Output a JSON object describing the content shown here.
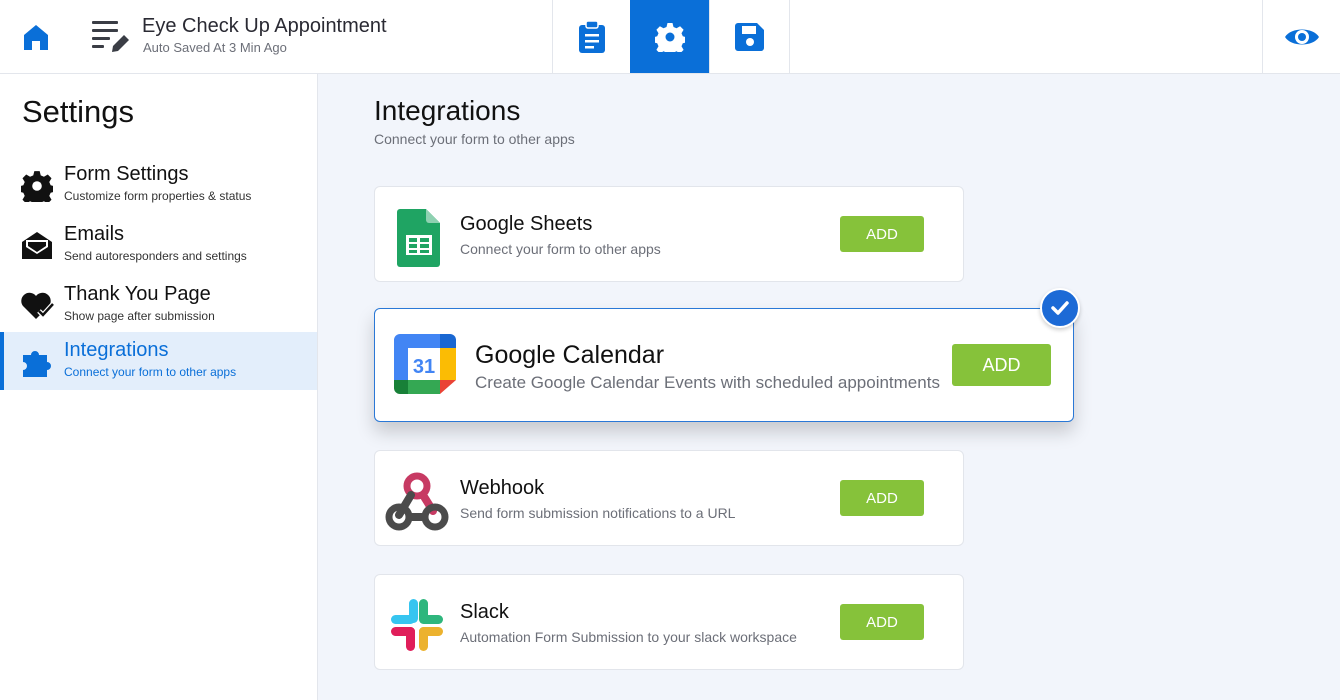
{
  "header": {
    "title": "Eye Check Up Appointment",
    "subtitle": "Auto Saved At 3 Min Ago"
  },
  "colors": {
    "accent": "#0a6fd8",
    "add_button": "#86c23a"
  },
  "sidebar": {
    "heading": "Settings",
    "items": [
      {
        "label": "Form Settings",
        "desc": "Customize form properties & status",
        "icon": "gear-icon"
      },
      {
        "label": "Emails",
        "desc": "Send autoresponders and settings",
        "icon": "envelope-icon"
      },
      {
        "label": "Thank You Page",
        "desc": "Show page after submission",
        "icon": "heart-check-icon"
      },
      {
        "label": "Integrations",
        "desc": "Connect your form to other apps",
        "icon": "puzzle-icon"
      }
    ]
  },
  "main": {
    "title": "Integrations",
    "subtitle": "Connect your form to other apps",
    "integrations": [
      {
        "name": "Google Sheets",
        "desc": "Connect your form to other apps",
        "button": "ADD"
      },
      {
        "name": "Google Calendar",
        "desc": "Create Google Calendar Events with scheduled appointments",
        "button": "ADD",
        "logo_text": "31"
      },
      {
        "name": "Webhook",
        "desc": "Send form submission notifications to a URL",
        "button": "ADD"
      },
      {
        "name": "Slack",
        "desc": "Automation Form Submission to your slack workspace",
        "button": "ADD"
      }
    ]
  }
}
